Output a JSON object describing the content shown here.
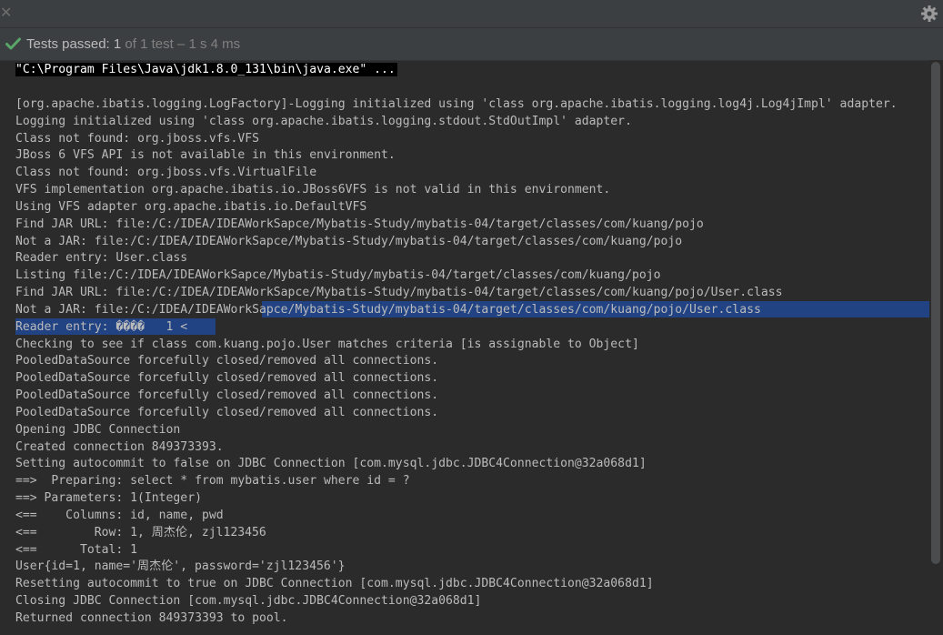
{
  "toolbar": {
    "close_glyph": "✕",
    "settings_icon": "gear-icon"
  },
  "status": {
    "icon": "check-icon",
    "passed_label": "Tests passed: ",
    "passed_count": "1",
    "detail": " of 1 test – 1 s 4 ms"
  },
  "console": {
    "command": "\"C:\\Program Files\\Java\\jdk1.8.0_131\\bin\\java.exe\" ...",
    "lines": [
      "",
      "[org.apache.ibatis.logging.LogFactory]-Logging initialized using 'class org.apache.ibatis.logging.log4j.Log4jImpl' adapter.",
      "Logging initialized using 'class org.apache.ibatis.logging.stdout.StdOutImpl' adapter.",
      "Class not found: org.jboss.vfs.VFS",
      "JBoss 6 VFS API is not available in this environment.",
      "Class not found: org.jboss.vfs.VirtualFile",
      "VFS implementation org.apache.ibatis.io.JBoss6VFS is not valid in this environment.",
      "Using VFS adapter org.apache.ibatis.io.DefaultVFS",
      "Find JAR URL: file:/C:/IDEA/IDEAWorkSapce/Mybatis-Study/mybatis-04/target/classes/com/kuang/pojo",
      "Not a JAR: file:/C:/IDEA/IDEAWorkSapce/Mybatis-Study/mybatis-04/target/classes/com/kuang/pojo",
      "Reader entry: User.class",
      "Listing file:/C:/IDEA/IDEAWorkSapce/Mybatis-Study/mybatis-04/target/classes/com/kuang/pojo",
      "Find JAR URL: file:/C:/IDEA/IDEAWorkSapce/Mybatis-Study/mybatis-04/target/classes/com/kuang/pojo/User.class",
      "Not a JAR: file:/C:/IDEA/IDEAWorkSapce/Mybatis-Study/mybatis-04/target/classes/com/kuang/pojo/User.class",
      "Reader entry: ����   1 <",
      "Checking to see if class com.kuang.pojo.User matches criteria [is assignable to Object]",
      "PooledDataSource forcefully closed/removed all connections.",
      "PooledDataSource forcefully closed/removed all connections.",
      "PooledDataSource forcefully closed/removed all connections.",
      "PooledDataSource forcefully closed/removed all connections.",
      "Opening JDBC Connection",
      "Created connection 849373393.",
      "Setting autocommit to false on JDBC Connection [com.mysql.jdbc.JDBC4Connection@32a068d1]",
      "==>  Preparing: select * from mybatis.user where id = ?",
      "==> Parameters: 1(Integer)",
      "<==    Columns: id, name, pwd",
      "<==        Row: 1, 周杰伦, zjl123456",
      "<==      Total: 1",
      "User{id=1, name='周杰伦', password='zjl123456'}",
      "Resetting autocommit to true on JDBC Connection [com.mysql.jdbc.JDBC4Connection@32a068d1]",
      "Closing JDBC Connection [com.mysql.jdbc.JDBC4Connection@32a068d1]",
      "Returned connection 849373393 to pool."
    ]
  },
  "colors": {
    "background": "#2b2b2b",
    "panel": "#3c3f41",
    "text": "#bbbbbb",
    "selection": "#214283",
    "success": "#59a869"
  }
}
